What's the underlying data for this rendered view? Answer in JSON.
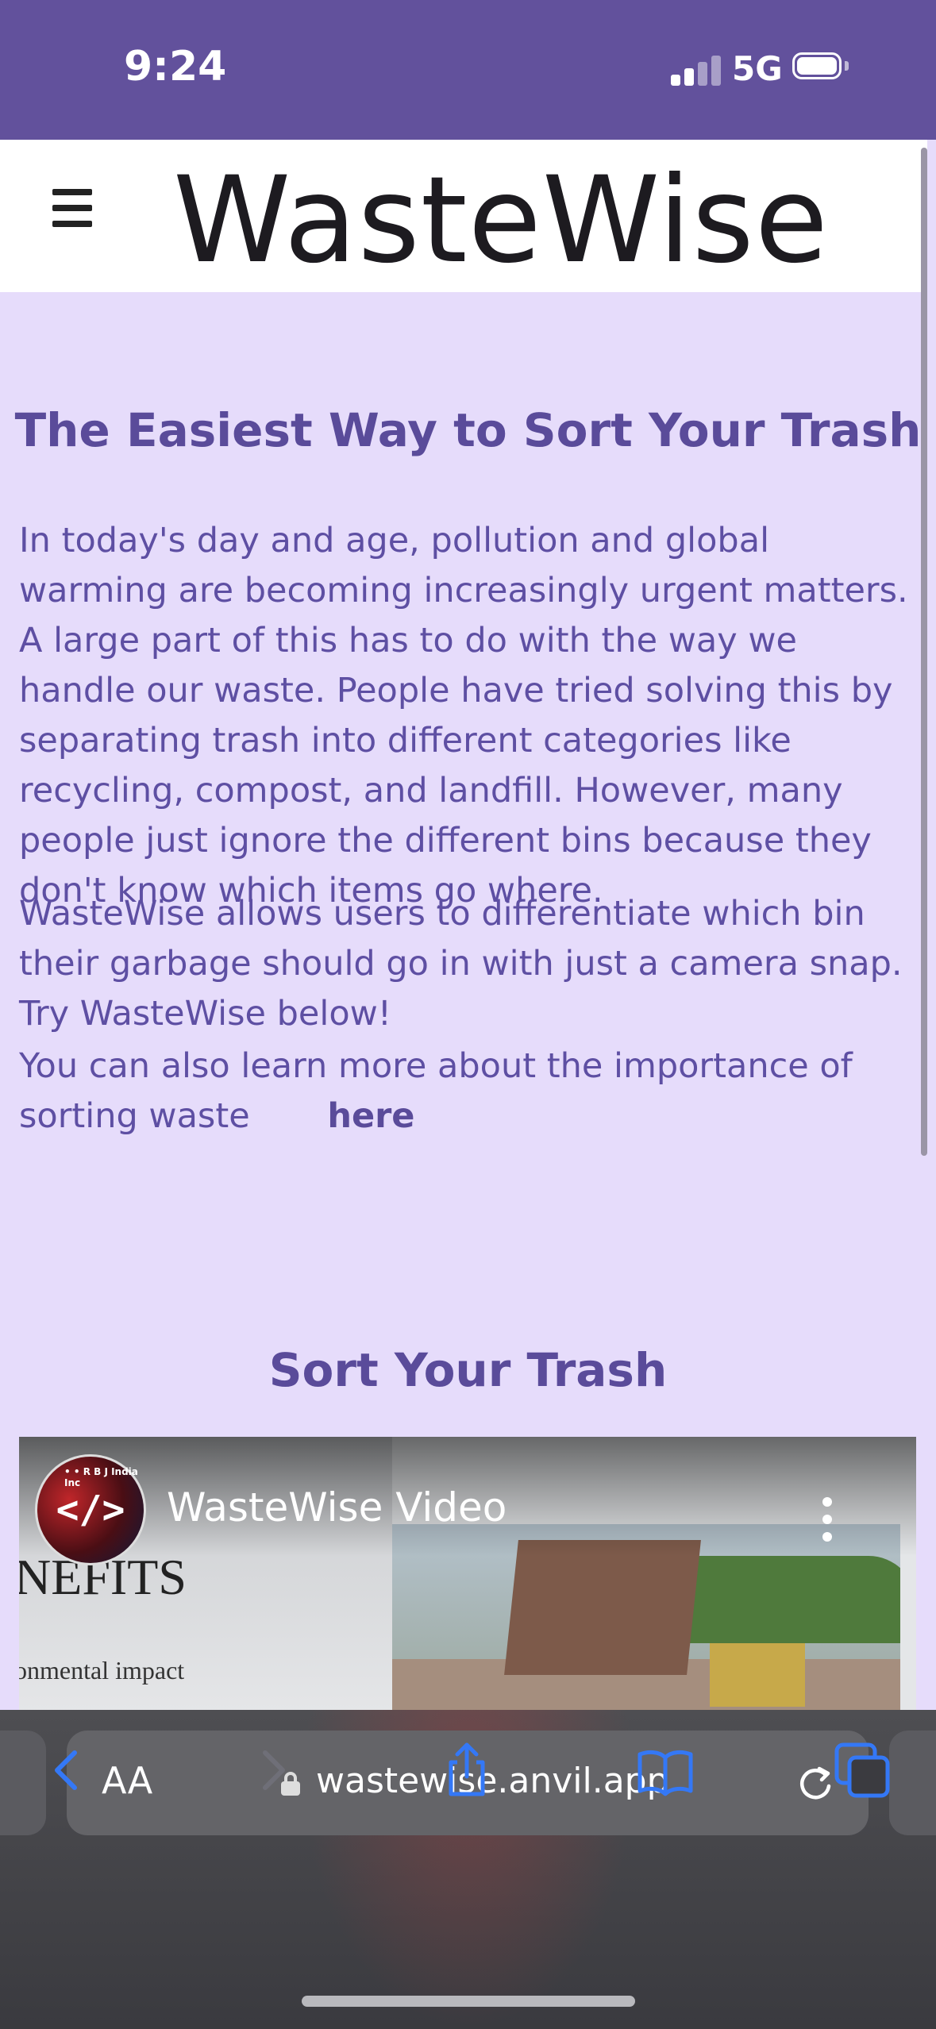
{
  "status_bar": {
    "time": "9:24",
    "network": "5G",
    "icons": [
      "cellular-signal-icon",
      "battery-icon"
    ]
  },
  "app": {
    "title": "WasteWise",
    "menu_icon": "hamburger-menu-icon"
  },
  "intro": {
    "headline": "The Easiest Way to Sort Your Trash",
    "paragraph1": "In today's day and age, pollution and global warming are becoming increasingly urgent matters. A large part of this has to do with the way we handle our waste. People have tried solving this by separating trash into different categories like recycling, compost, and landfill. However, many people just ignore the different bins because they don't know which items go where.",
    "paragraph2": "WasteWise allows users to differentiate which bin their garbage should go in with just a camera snap. Try WasteWise below!",
    "paragraph3": "You can also learn more about the importance of sorting waste",
    "link_label": "here"
  },
  "sort_section": {
    "title": "Sort Your Trash",
    "video": {
      "title": "WasteWise Video",
      "slide_heading": "NEFITS",
      "slide_caption": "onmental impact",
      "channel_logo_text": "</>",
      "channel_logo_tag": "• • R B J India Inc"
    }
  },
  "browser": {
    "text_size_label": "AA",
    "url": "wastewise.anvil.app",
    "toolbar_icons": [
      "back-icon",
      "forward-icon",
      "share-icon",
      "bookmarks-icon",
      "tabs-icon"
    ],
    "accent_color": "#3478f6"
  },
  "colors": {
    "status_bar": "#62519c",
    "page_background": "#e6dcfb",
    "heading_text": "#5a4b9a",
    "body_text": "#5e4fa3"
  }
}
